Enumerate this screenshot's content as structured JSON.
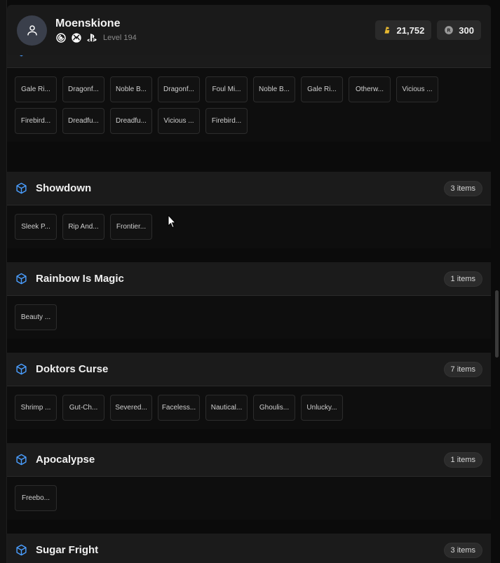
{
  "header": {
    "username": "Moenskione",
    "level": "Level 194",
    "currencies": [
      {
        "icon": "renown-icon",
        "value": "21,752"
      },
      {
        "icon": "r6-credits-icon",
        "value": "300"
      }
    ],
    "platforms": [
      "ubisoft-icon",
      "xbox-icon",
      "playstation-icon"
    ]
  },
  "colors": {
    "accent": "#4a9eff",
    "background": "#0b0b0b",
    "header": "#1a1a1a"
  },
  "sections": [
    {
      "title": "",
      "count": "",
      "items": [
        "Gale Ri...",
        "Dragonf...",
        "Noble B...",
        "Dragonf...",
        "Foul Mi...",
        "Noble B...",
        "Gale Ri...",
        "Otherw...",
        "Vicious ...",
        "Firebird...",
        "Dreadfu...",
        "Dreadfu...",
        "Vicious ...",
        "Firebird..."
      ]
    },
    {
      "title": "Showdown",
      "count": "3 items",
      "items": [
        "Sleek P...",
        "Rip And...",
        "Frontier..."
      ]
    },
    {
      "title": "Rainbow Is Magic",
      "count": "1 items",
      "items": [
        "Beauty ..."
      ]
    },
    {
      "title": "Doktors Curse",
      "count": "7 items",
      "items": [
        "Shrimp ...",
        "Gut-Ch...",
        "Severed...",
        "Faceless...",
        "Nautical...",
        "Ghoulis...",
        "Unlucky..."
      ]
    },
    {
      "title": "Apocalypse",
      "count": "1 items",
      "items": [
        "Freebo..."
      ]
    },
    {
      "title": "Sugar Fright",
      "count": "3 items",
      "items": []
    }
  ]
}
